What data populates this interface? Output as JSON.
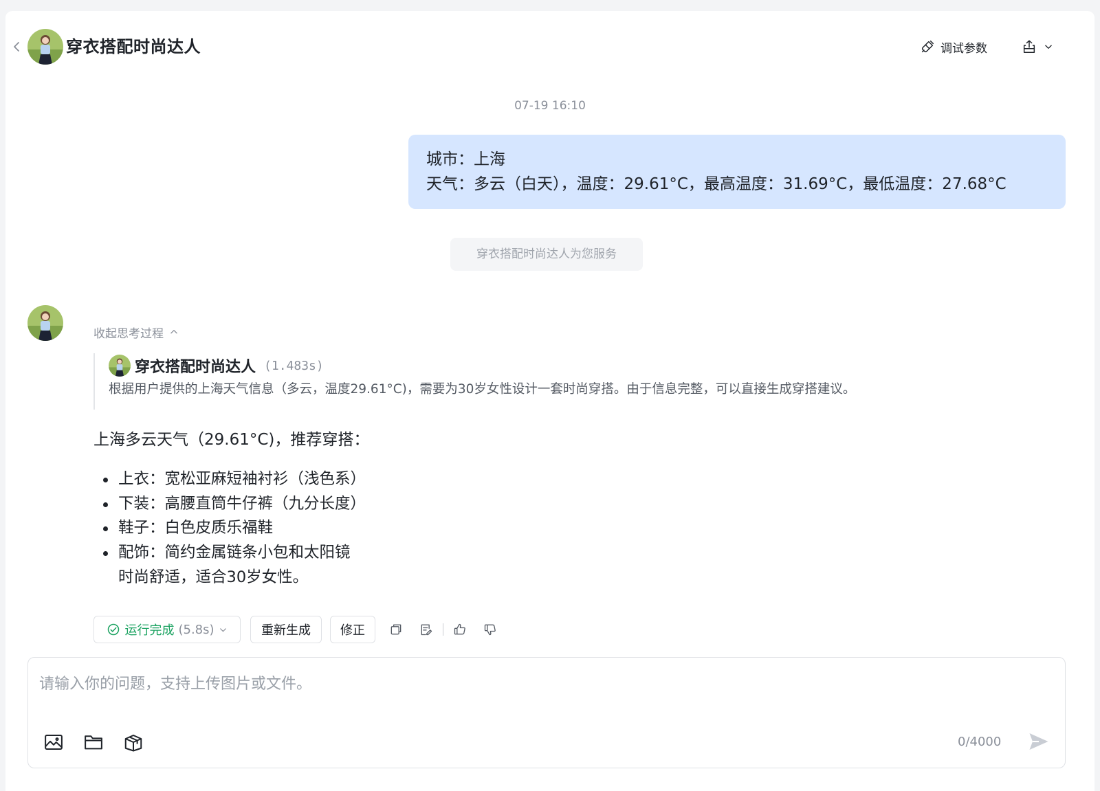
{
  "header": {
    "title": "穿衣搭配时尚达人",
    "debug_label": "调试参数"
  },
  "conversation": {
    "timestamp": "07-19 16:10",
    "user_message": {
      "line1": "城市：上海",
      "line2": "天气：多云（白天），温度：29.61°C，最高温度：31.69°C，最低温度：27.68°C"
    },
    "service_notice": "穿衣搭配时尚达人为您服务",
    "bot": {
      "collapse_label": "收起思考过程",
      "thinking_name": "穿衣搭配时尚达人",
      "thinking_time": "(1.483s)",
      "thinking_text": "根据用户提供的上海天气信息（多云，温度29.61°C)，需要为30岁女性设计一套时尚穿搭。由于信息完整，可以直接生成穿搭建议。",
      "answer_title": "上海多云天气（29.61°C)，推荐穿搭：",
      "answer_items": [
        "上衣：宽松亚麻短袖衬衫（浅色系）",
        "下装：高腰直筒牛仔裤（九分长度）",
        "鞋子：白色皮质乐福鞋",
        "配饰：简约金属链条小包和太阳镜"
      ],
      "answer_tail": "时尚舒适，适合30岁女性。"
    }
  },
  "actions": {
    "status_label": "运行完成",
    "status_duration": "(5.8s)",
    "regenerate_label": "重新生成",
    "fix_label": "修正"
  },
  "composer": {
    "placeholder": "请输入你的问题，支持上传图片或文件。",
    "counter": "0/4000"
  },
  "colors": {
    "user_bubble": "#d6e6ff",
    "success_green": "#1aa260",
    "muted_text": "#8a8f99"
  },
  "icons": {
    "back": "chevron-left-icon",
    "debug": "plug-icon",
    "share": "share-icon",
    "image": "image-icon",
    "folder": "folder-icon",
    "box": "package-icon",
    "send": "send-icon"
  }
}
